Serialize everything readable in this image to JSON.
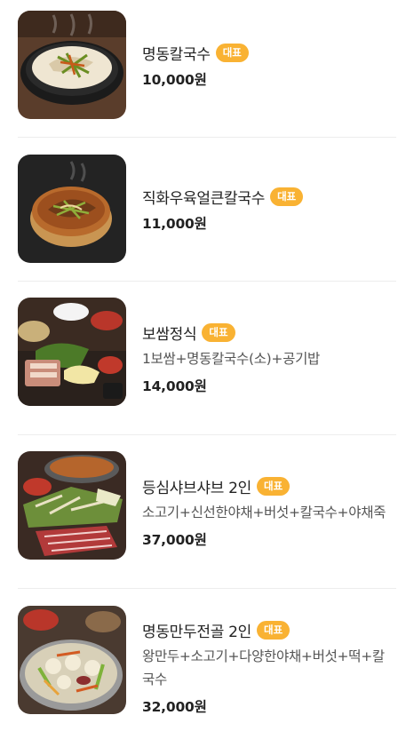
{
  "badge_label": "대표",
  "colors": {
    "badge": "#f9b233",
    "divider": "#ededed"
  },
  "menu": [
    {
      "name": "명동칼국수",
      "description": "",
      "price": "10,000원",
      "image": "kalguksu-bowl"
    },
    {
      "name": "직화우육얼큰칼국수",
      "description": "",
      "price": "11,000원",
      "image": "spicy-beef-kalguksu"
    },
    {
      "name": "보쌈정식",
      "description": "1보쌈+명동칼국수(소)+공기밥",
      "price": "14,000원",
      "image": "bossam-set"
    },
    {
      "name": "등심샤브샤브 2인",
      "description": "소고기+신선한야채+버섯+칼국수+야채죽",
      "price": "37,000원",
      "image": "sirloin-shabu"
    },
    {
      "name": "명동만두전골 2인",
      "description": "왕만두+소고기+다양한야채+버섯+떡+칼국수",
      "price": "32,000원",
      "image": "mandu-jeongol"
    }
  ]
}
